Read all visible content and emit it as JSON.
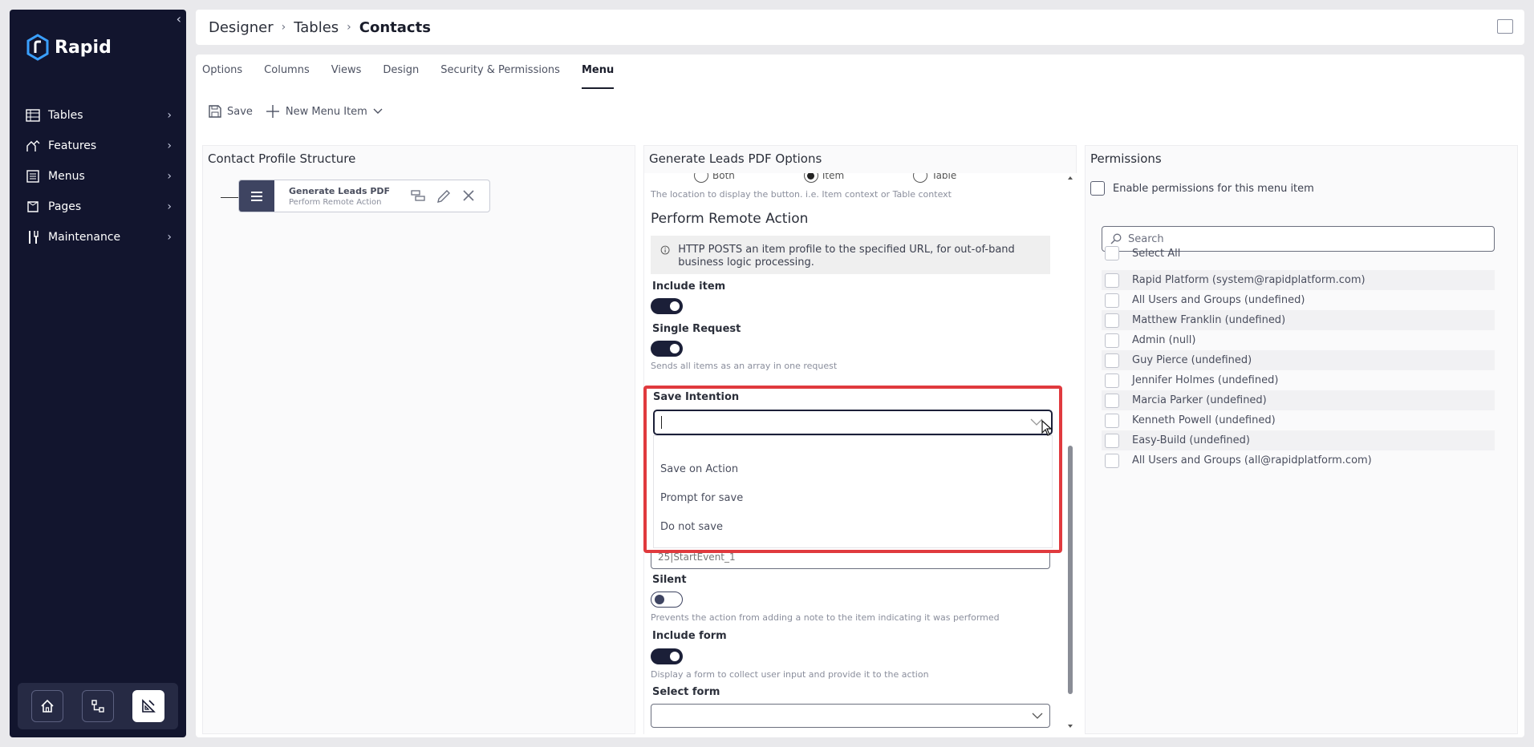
{
  "app": {
    "name": "Rapid"
  },
  "sidebar": {
    "items": [
      {
        "label": "Tables",
        "icon": "table-icon"
      },
      {
        "label": "Features",
        "icon": "features-icon"
      },
      {
        "label": "Menus",
        "icon": "menu-list-icon"
      },
      {
        "label": "Pages",
        "icon": "pages-icon"
      },
      {
        "label": "Maintenance",
        "icon": "tools-icon"
      }
    ],
    "bottom_buttons": [
      "home-icon",
      "flow-icon",
      "designer-icon"
    ]
  },
  "breadcrumb": {
    "items": [
      "Designer",
      "Tables",
      "Contacts"
    ]
  },
  "tabs": [
    "Options",
    "Columns",
    "Views",
    "Design",
    "Security & Permissions",
    "Menu"
  ],
  "active_tab": "Menu",
  "toolbar": {
    "save_label": "Save",
    "new_item_label": "New Menu Item"
  },
  "left_panel": {
    "title": "Contact Profile Structure",
    "node": {
      "title": "Generate Leads PDF",
      "subtitle": "Perform Remote Action"
    }
  },
  "middle_panel": {
    "title": "Generate Leads PDF Options",
    "radio_options": [
      "Both",
      "Item",
      "Table"
    ],
    "radio_selected": "Item",
    "location_help": "The location to display the button. i.e. Item context or Table context",
    "section_title": "Perform Remote Action",
    "info_text": "HTTP POSTS an item profile to the specified URL, for out-of-band business logic processing.",
    "include_item_label": "Include item",
    "single_request_label": "Single Request",
    "single_request_help": "Sends all items as an array in one request",
    "save_intention": {
      "label": "Save Intention",
      "options": [
        "Save on Action",
        "Prompt for save",
        "Do not save"
      ]
    },
    "event_value": "25|StartEvent_1",
    "silent_label": "Silent",
    "silent_help": "Prevents the action from adding a note to the item indicating it was performed",
    "include_form_label": "Include form",
    "include_form_help": "Display a form to collect user input and provide it to the action",
    "select_form_label": "Select form"
  },
  "right_panel": {
    "title": "Permissions",
    "enable_label": "Enable permissions for this menu item",
    "search_placeholder": "Search",
    "select_all_label": "Select All",
    "users": [
      "Rapid Platform (system@rapidplatform.com)",
      "All Users and Groups (undefined)",
      "Matthew Franklin (undefined)",
      "Admin (null)",
      "Guy Pierce (undefined)",
      "Jennifer Holmes (undefined)",
      "Marcia Parker (undefined)",
      "Kenneth Powell (undefined)",
      "Easy-Build (undefined)",
      "All Users and Groups (all@rapidplatform.com)"
    ]
  },
  "colors": {
    "sidebar_bg": "#12152e",
    "accent": "#1b1f38",
    "highlight": "#e03a3e"
  }
}
